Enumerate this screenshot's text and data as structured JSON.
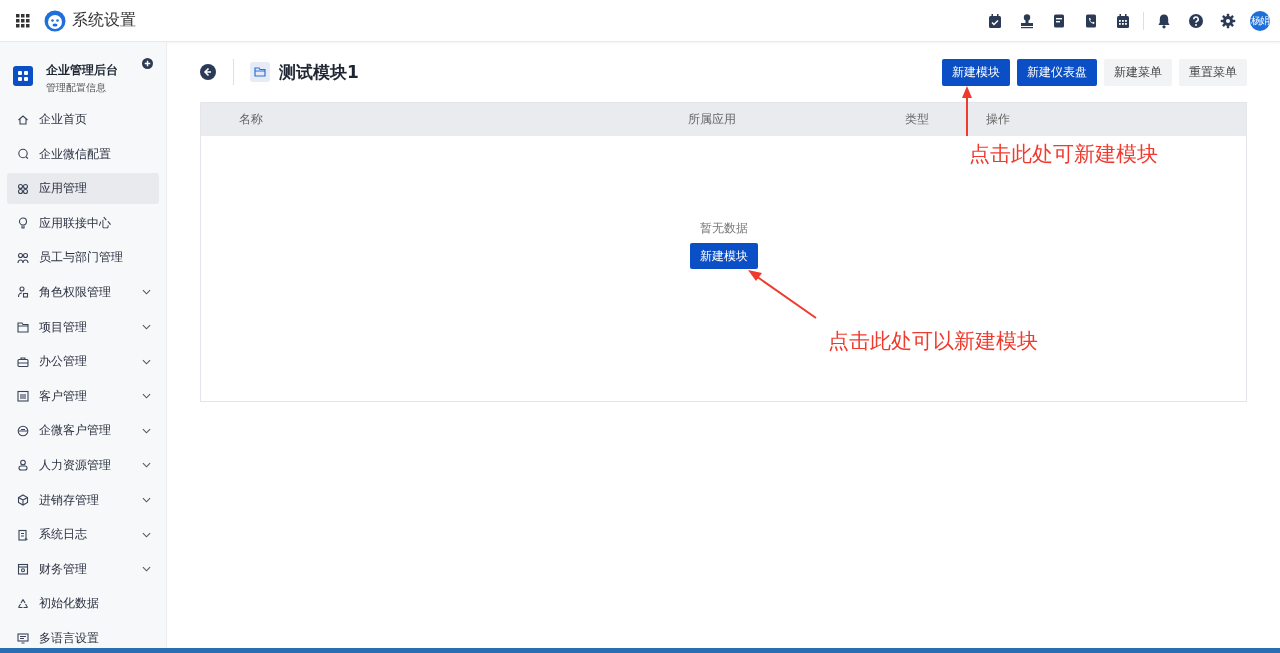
{
  "app": {
    "title": "系统设置",
    "user_avatar": "杨娟"
  },
  "sidebar": {
    "title": "企业管理后台",
    "subtitle": "管理配置信息",
    "items": [
      {
        "label": "企业首页",
        "expandable": false,
        "selected": false
      },
      {
        "label": "企业微信配置",
        "expandable": false,
        "selected": false
      },
      {
        "label": "应用管理",
        "expandable": false,
        "selected": true
      },
      {
        "label": "应用联接中心",
        "expandable": false,
        "selected": false
      },
      {
        "label": "员工与部门管理",
        "expandable": false,
        "selected": false
      },
      {
        "label": "角色权限管理",
        "expandable": true,
        "selected": false
      },
      {
        "label": "项目管理",
        "expandable": true,
        "selected": false
      },
      {
        "label": "办公管理",
        "expandable": true,
        "selected": false
      },
      {
        "label": "客户管理",
        "expandable": true,
        "selected": false
      },
      {
        "label": "企微客户管理",
        "expandable": true,
        "selected": false
      },
      {
        "label": "人力资源管理",
        "expandable": true,
        "selected": false
      },
      {
        "label": "进销存管理",
        "expandable": true,
        "selected": false
      },
      {
        "label": "系统日志",
        "expandable": true,
        "selected": false
      },
      {
        "label": "财务管理",
        "expandable": true,
        "selected": false
      },
      {
        "label": "初始化数据",
        "expandable": false,
        "selected": false
      },
      {
        "label": "多语言设置",
        "expandable": false,
        "selected": false
      }
    ]
  },
  "page": {
    "title": "测试模块1",
    "buttons": [
      {
        "label": "新建模块",
        "kind": "primary"
      },
      {
        "label": "新建仪表盘",
        "kind": "primary"
      },
      {
        "label": "新建菜单",
        "kind": "secondary"
      },
      {
        "label": "重置菜单",
        "kind": "secondary"
      }
    ],
    "table": {
      "columns": [
        "名称",
        "所属应用",
        "类型",
        "操作"
      ],
      "empty_text": "暂无数据",
      "empty_button": "新建模块"
    }
  },
  "annotations": [
    "点击此处可新建模块",
    "点击此处可以新建模块"
  ]
}
